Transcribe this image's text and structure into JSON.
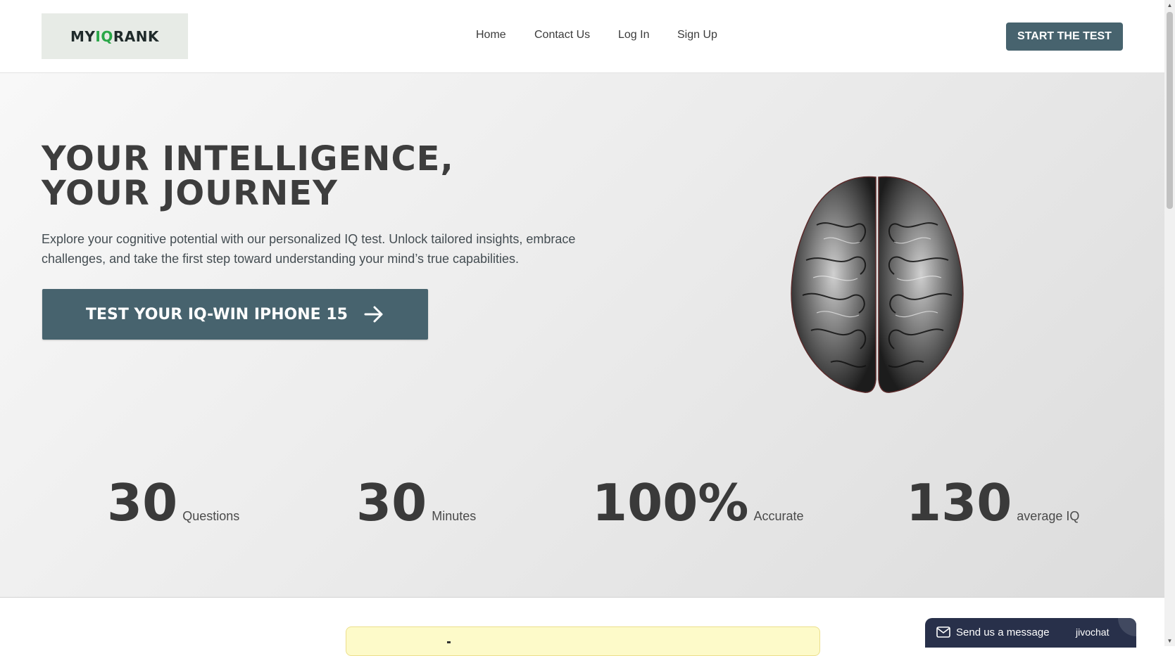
{
  "header": {
    "logo": {
      "part1": "MY",
      "part2": "IQ",
      "part3": "RANK"
    },
    "nav": [
      "Home",
      "Contact Us",
      "Log In",
      "Sign Up"
    ],
    "cta_label": "START THE TEST"
  },
  "hero": {
    "title": "YOUR INTELLIGENCE,\nYOUR JOURNEY",
    "description": "Explore your cognitive potential with our personalized IQ test. Unlock tailored insights, embrace challenges, and take the first step toward understanding your mind’s true capabilities.",
    "cta_label": "TEST YOUR IQ-WIN IPHONE 15",
    "cta_icon": "arrow-right-icon",
    "image": "brain-illustration"
  },
  "stats": [
    {
      "value": "30",
      "label": "Questions"
    },
    {
      "value": "30",
      "label": "Minutes"
    },
    {
      "value": "100%",
      "label": "Accurate"
    },
    {
      "value": "130",
      "label": "average IQ"
    }
  ],
  "chat": {
    "message_label": "Send us a message",
    "brand": "jivochat",
    "icon": "mail-icon"
  },
  "colors": {
    "primary": "#47636e",
    "logo_accent": "#2aa748",
    "logo_bg": "#e7ebe6",
    "chat_bg": "#28304a",
    "notice_bg": "#fdfac9"
  }
}
